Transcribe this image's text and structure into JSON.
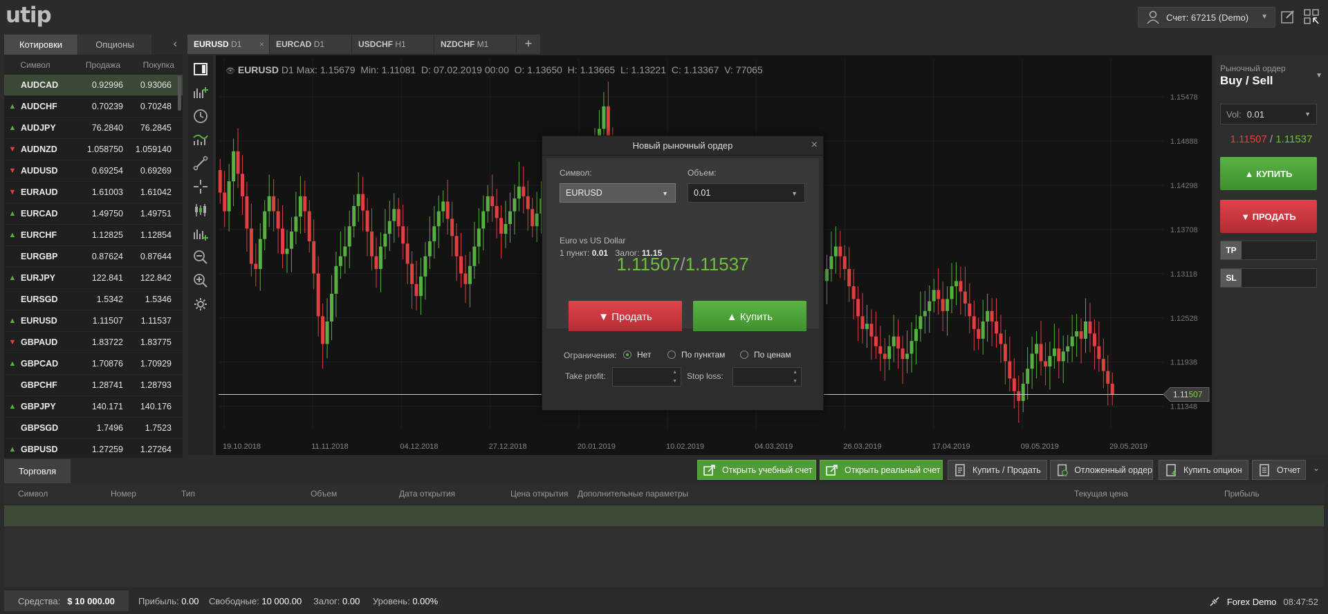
{
  "logo": "utip",
  "account": {
    "label": "Счет: 67215 (Demo)"
  },
  "left_panel": {
    "tabs": [
      "Котировки",
      "Опционы"
    ],
    "columns": {
      "symbol": "Символ",
      "sell": "Продажа",
      "buy": "Покупка"
    },
    "quotes": [
      {
        "dir": "none",
        "symbol": "AUDCAD",
        "sell": "0.92996",
        "buy": "0.93066",
        "selected": true
      },
      {
        "dir": "up",
        "symbol": "AUDCHF",
        "sell": "0.70239",
        "buy": "0.70248"
      },
      {
        "dir": "up",
        "symbol": "AUDJPY",
        "sell": "76.2840",
        "buy": "76.2845"
      },
      {
        "dir": "down",
        "symbol": "AUDNZD",
        "sell": "1.058750",
        "buy": "1.059140"
      },
      {
        "dir": "down",
        "symbol": "AUDUSD",
        "sell": "0.69254",
        "buy": "0.69269"
      },
      {
        "dir": "down",
        "symbol": "EURAUD",
        "sell": "1.61003",
        "buy": "1.61042"
      },
      {
        "dir": "up",
        "symbol": "EURCAD",
        "sell": "1.49750",
        "buy": "1.49751"
      },
      {
        "dir": "up",
        "symbol": "EURCHF",
        "sell": "1.12825",
        "buy": "1.12854"
      },
      {
        "dir": "none",
        "symbol": "EURGBP",
        "sell": "0.87624",
        "buy": "0.87644"
      },
      {
        "dir": "up",
        "symbol": "EURJPY",
        "sell": "122.841",
        "buy": "122.842"
      },
      {
        "dir": "none",
        "symbol": "EURSGD",
        "sell": "1.5342",
        "buy": "1.5346"
      },
      {
        "dir": "up",
        "symbol": "EURUSD",
        "sell": "1.11507",
        "buy": "1.11537"
      },
      {
        "dir": "down",
        "symbol": "GBPAUD",
        "sell": "1.83722",
        "buy": "1.83775"
      },
      {
        "dir": "up",
        "symbol": "GBPCAD",
        "sell": "1.70876",
        "buy": "1.70929"
      },
      {
        "dir": "none",
        "symbol": "GBPCHF",
        "sell": "1.28741",
        "buy": "1.28793"
      },
      {
        "dir": "up",
        "symbol": "GBPJPY",
        "sell": "140.171",
        "buy": "140.176"
      },
      {
        "dir": "none",
        "symbol": "GBPSGD",
        "sell": "1.7496",
        "buy": "1.7523"
      },
      {
        "dir": "up",
        "symbol": "GBPUSD",
        "sell": "1.27259",
        "buy": "1.27264"
      }
    ]
  },
  "chart_tabs": [
    {
      "symbol": "EURUSD",
      "tf": "D1",
      "active": true
    },
    {
      "symbol": "EURCAD",
      "tf": "D1"
    },
    {
      "symbol": "USDCHF",
      "tf": "H1"
    },
    {
      "symbol": "NZDCHF",
      "tf": "M1"
    }
  ],
  "chart_info": {
    "symbol": "EURUSD",
    "tf": "D1",
    "stats": "Max: 1.15679  Min: 1.11081  D: 07.02.2019 00:00  O: 1.13650  H: 1.13665  L: 1.13221  C: 1.13367  V: 77065"
  },
  "colors": {
    "up": "#58b043",
    "down": "#e04040",
    "accent_green": "#4f9b36",
    "accent_red": "#c0333a"
  },
  "chart_data": {
    "type": "candlestick",
    "ylim": [
      1.1105,
      1.158
    ],
    "y_ticks": [
      "1.15478",
      "1.14888",
      "1.14298",
      "1.13708",
      "1.13118",
      "1.12528",
      "1.11938",
      "1.11348"
    ],
    "x_ticks": [
      "19.10.2018",
      "11.11.2018",
      "04.12.2018",
      "27.12.2018",
      "20.01.2019",
      "10.02.2019",
      "04.03.2019",
      "26.03.2019",
      "17.04.2019",
      "09.05.2019",
      "29.05.2019"
    ],
    "current_price": "1.11507",
    "current_price_prefix": "1.11",
    "current_price_suffix": "507",
    "closes": [
      1.142,
      1.1395,
      1.1435,
      1.1475,
      1.1445,
      1.1415,
      1.1372,
      1.1325,
      1.1318,
      1.1358,
      1.1395,
      1.1415,
      1.1395,
      1.1372,
      1.1338,
      1.1345,
      1.1368,
      1.1388,
      1.1415,
      1.1395,
      1.1355,
      1.1312,
      1.1255,
      1.1218,
      1.1248,
      1.1285,
      1.1322,
      1.1335,
      1.1348,
      1.1375,
      1.1402,
      1.1418,
      1.1396,
      1.1368,
      1.1335,
      1.1318,
      1.1348,
      1.1365,
      1.1382,
      1.1398,
      1.1375,
      1.1352,
      1.1325,
      1.1298,
      1.1282,
      1.1308,
      1.1335,
      1.1355,
      1.1375,
      1.1395,
      1.1408,
      1.1385,
      1.1362,
      1.1335,
      1.1312,
      1.1298,
      1.1322,
      1.1348,
      1.1372,
      1.1395,
      1.1415,
      1.1402,
      1.1386,
      1.1365,
      1.1378,
      1.1395,
      1.1412,
      1.1428,
      1.1415,
      1.1398,
      1.1375,
      1.1392,
      1.1412,
      1.1435,
      1.1418,
      1.1398,
      1.1378,
      1.1362,
      1.1345,
      1.1368,
      1.1388,
      1.1408,
      1.1425,
      1.1448,
      1.1475,
      1.1505,
      1.1535,
      1.148,
      1.145,
      1.1425,
      1.1398,
      1.1375,
      1.1385,
      1.1402,
      1.1418,
      1.1432,
      1.1445,
      1.1425,
      1.1402,
      1.1395,
      1.1412,
      1.1428,
      1.1418,
      1.1405,
      1.1398,
      1.1412,
      1.1435,
      1.1455,
      1.1438,
      1.1418,
      1.1395,
      1.1372,
      1.1355,
      1.1368,
      1.1385,
      1.1378,
      1.1362,
      1.1345,
      1.1338,
      1.1352,
      1.1365,
      1.1352,
      1.1335,
      1.1318,
      1.1302,
      1.1315,
      1.1325,
      1.1318,
      1.1305,
      1.1295,
      1.1308,
      1.1322,
      1.1335,
      1.1328,
      1.1315,
      1.1302,
      1.1318,
      1.1335,
      1.1348,
      1.1335,
      1.1318,
      1.1295,
      1.1278,
      1.1255,
      1.1238,
      1.1245,
      1.1228,
      1.1215,
      1.1205,
      1.1198,
      1.1215,
      1.1228,
      1.1212,
      1.1198,
      1.1205,
      1.1222,
      1.1238,
      1.1255,
      1.1262,
      1.1275,
      1.129,
      1.1278,
      1.1262,
      1.1278,
      1.1295,
      1.1302,
      1.1288,
      1.1272,
      1.1255,
      1.1238,
      1.1225,
      1.1248,
      1.1262,
      1.1248,
      1.1232,
      1.1218,
      1.1195,
      1.1172,
      1.1155,
      1.1142,
      1.1165,
      1.1185,
      1.1205,
      1.1218,
      1.1195,
      1.1188,
      1.1202,
      1.1212,
      1.1195,
      1.1208,
      1.1215,
      1.1228,
      1.1235,
      1.1225,
      1.1248,
      1.1232,
      1.1215,
      1.1198,
      1.1182,
      1.1165,
      1.1151
    ]
  },
  "right_panel": {
    "title_small": "Рыночный ордер",
    "title": "Buy / Sell",
    "vol_label": "Vol:",
    "vol_value": "0.01",
    "sell_price": "1.11507",
    "buy_price": "1.11537",
    "buy_label": "▲ КУПИТЬ",
    "sell_label": "▼ ПРОДАТЬ",
    "tp_label": "TP",
    "sl_label": "SL"
  },
  "modal": {
    "title": "Новый рыночный ордер",
    "symbol_label": "Символ:",
    "symbol_value": "EURUSD",
    "volume_label": "Объем:",
    "volume_value": "0.01",
    "desc": "Euro vs US Dollar",
    "point_label": "1 пункт:",
    "point_value": "0.01",
    "margin_label": "Залог:",
    "margin_value": "11.15",
    "sell_price": "1.11507",
    "buy_price": "1.11537",
    "sell_label": "▼ Продать",
    "buy_label": "▲ Купить",
    "limits_label": "Ограничения:",
    "opt_none": "Нет",
    "opt_points": "По пунктам",
    "opt_prices": "По ценам",
    "tp_label": "Take profit:",
    "sl_label": "Stop loss:"
  },
  "bottom": {
    "tab": "Торговля",
    "buttons": {
      "demo": "Открыть учебный счет",
      "real": "Открыть реальный счет",
      "buysell": "Купить / Продать",
      "pending": "Отложенный ордер",
      "option": "Купить опцион",
      "report": "Отчет"
    },
    "columns": [
      "Символ",
      "Номер",
      "Тип",
      "Объем",
      "Дата открытия",
      "Цена открытия",
      "Дополнительные параметры",
      "Текущая цена",
      "Прибыль"
    ]
  },
  "status": {
    "funds_label": "Средства:",
    "funds_value": "$ 10 000.00",
    "profit_label": "Прибыль:",
    "profit_value": "0.00",
    "free_label": "Свободные:",
    "free_value": "10 000.00",
    "margin_label": "Залог:",
    "margin_value": "0.00",
    "level_label": "Уровень:",
    "level_value": "0.00%",
    "server": "Forex Demo",
    "time": "08:47:52"
  }
}
